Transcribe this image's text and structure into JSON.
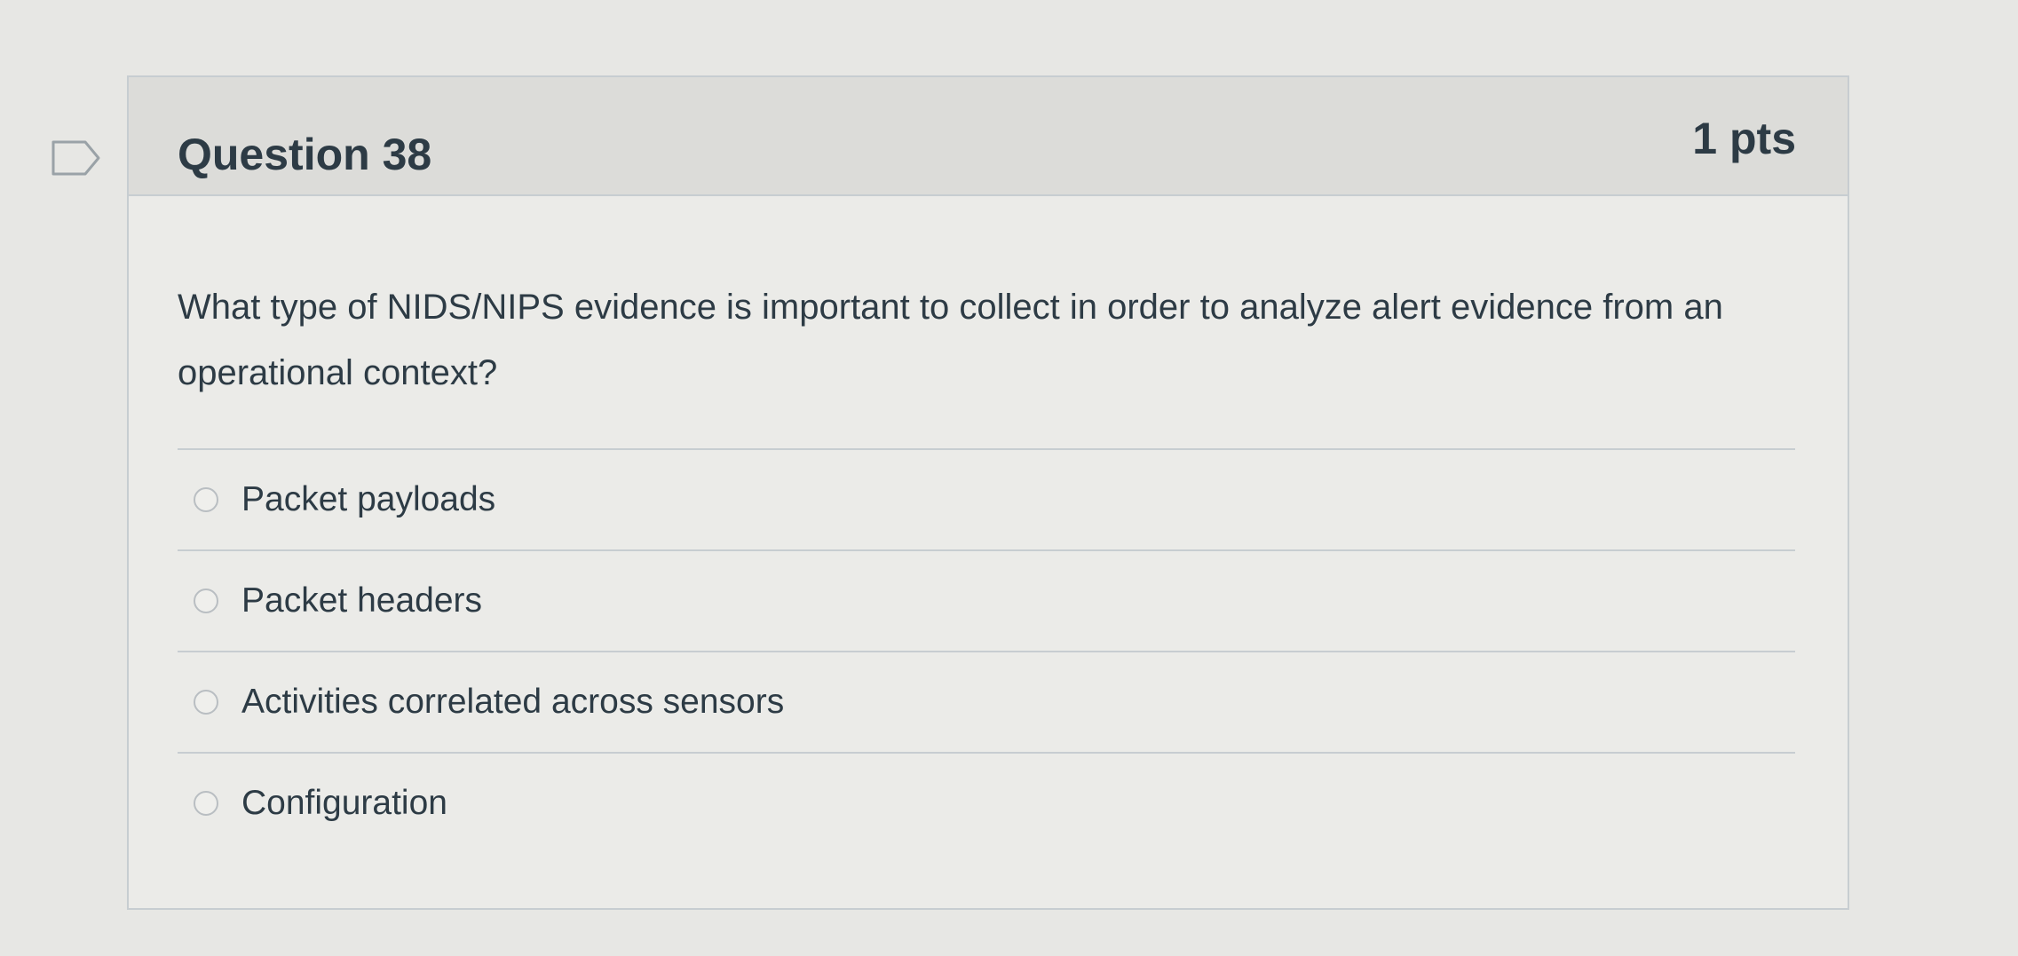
{
  "question": {
    "title": "Question 38",
    "points": "1 pts",
    "text": "What type of NIDS/NIPS evidence is important to collect in order to analyze alert evidence from an operational context?",
    "flag_icon": "bookmark-flag-icon",
    "answers": [
      {
        "label": "Packet payloads",
        "selected": false
      },
      {
        "label": "Packet headers",
        "selected": false
      },
      {
        "label": "Activities correlated across sensors",
        "selected": false
      },
      {
        "label": "Configuration",
        "selected": false
      }
    ]
  },
  "colors": {
    "text": "#2d3b45",
    "header_bg": "#dcdcd9",
    "border": "#c7cdd1"
  }
}
